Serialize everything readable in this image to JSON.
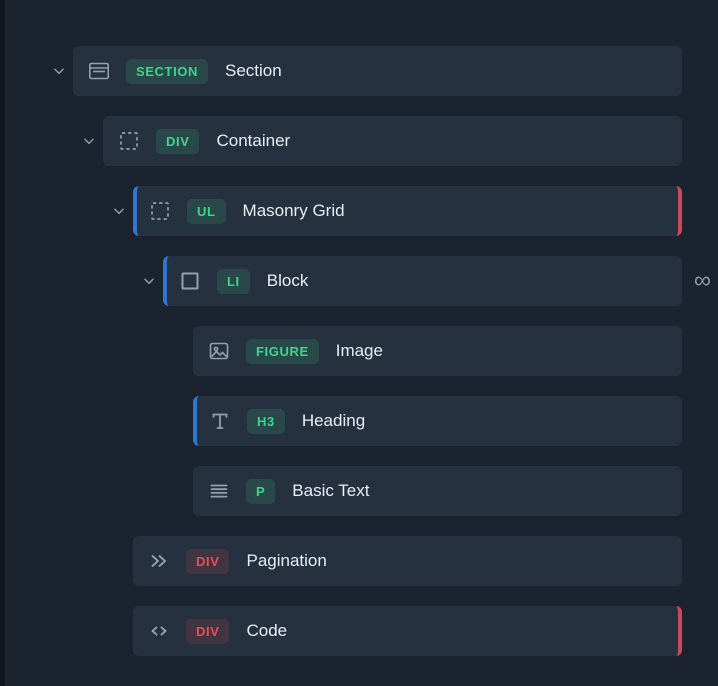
{
  "colors": {
    "panel_bg": "#1a232e",
    "row_bg": "#26313f",
    "accent_blue": "#2e77d0",
    "accent_red": "#c9485c",
    "tag_green": "#3dd68c",
    "tag_red": "#ef4b57",
    "icon_gray": "#93a1af",
    "label_text": "#e8edf2"
  },
  "icons": {
    "infinity_glyph": "∞"
  },
  "rows": [
    {
      "label": "Section",
      "tag": "SECTION",
      "tag_type": "green",
      "icon": "section-icon",
      "indent": 0,
      "expandable": true
    },
    {
      "label": "Container",
      "tag": "DIV",
      "tag_type": "green",
      "icon": "container-icon",
      "indent": 1,
      "expandable": true
    },
    {
      "label": "Masonry Grid",
      "tag": "UL",
      "tag_type": "green",
      "icon": "grid-icon",
      "indent": 2,
      "expandable": true,
      "left_accent": true,
      "right_accent": true
    },
    {
      "label": "Block",
      "tag": "LI",
      "tag_type": "green",
      "icon": "block-icon",
      "indent": 3,
      "expandable": true,
      "left_accent": true,
      "linked": true
    },
    {
      "label": "Image",
      "tag": "FIGURE",
      "tag_type": "green",
      "icon": "image-icon",
      "indent": 4
    },
    {
      "label": "Heading",
      "tag": "H3",
      "tag_type": "green",
      "icon": "heading-icon",
      "indent": 4,
      "left_accent": true
    },
    {
      "label": "Basic Text",
      "tag": "P",
      "tag_type": "green",
      "icon": "text-lines-icon",
      "indent": 4
    },
    {
      "label": "Pagination",
      "tag": "DIV",
      "tag_type": "red",
      "icon": "double-chevron-icon",
      "indent": 2
    },
    {
      "label": "Code",
      "tag": "DIV",
      "tag_type": "red",
      "icon": "code-icon",
      "indent": 2,
      "right_accent": true
    }
  ]
}
